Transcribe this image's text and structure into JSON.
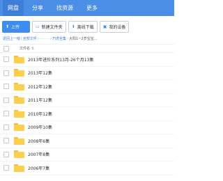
{
  "nav": {
    "tabs": [
      {
        "label": "网盘",
        "active": true
      },
      {
        "label": "分享",
        "active": false
      },
      {
        "label": "找资源",
        "active": false
      },
      {
        "label": "更多",
        "active": false
      }
    ]
  },
  "toolbar": {
    "upload_label": "上传",
    "new_folder_label": "新建文件夹",
    "offline_download_label": "离线下载",
    "my_devices_label": "我的设备"
  },
  "breadcrumb": {
    "back": "返回上一级",
    "all_files": "全部文件",
    "hidden_segment": "·········",
    "parent": "巧虎全集",
    "current": "大阳1~2岁宝宝..."
  },
  "list": {
    "column_name": "文件名",
    "items": [
      "2013年进阶系列13月-26个月13集",
      "2013年12集",
      "2012年12集",
      "2011年12集",
      "2010年12集",
      "2009年10集",
      "2008年6集",
      "2007年8集",
      "2006年7集"
    ]
  },
  "colors": {
    "nav_bg": "#4a8ee8",
    "accent": "#3b8cf3",
    "folder": "#fcd04d"
  }
}
